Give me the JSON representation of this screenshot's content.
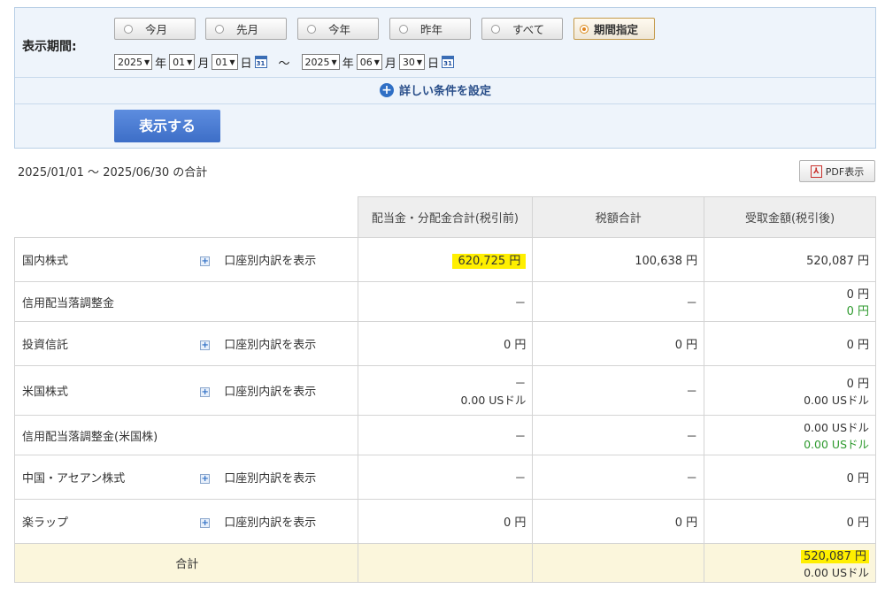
{
  "filter": {
    "label": "表示期間:",
    "periods": [
      {
        "label": "今月",
        "active": false
      },
      {
        "label": "先月",
        "active": false
      },
      {
        "label": "今年",
        "active": false
      },
      {
        "label": "昨年",
        "active": false
      },
      {
        "label": "すべて",
        "active": false
      },
      {
        "label": "期間指定",
        "active": true
      }
    ],
    "from": {
      "year": "2025",
      "month": "01",
      "day": "01"
    },
    "to": {
      "year": "2025",
      "month": "06",
      "day": "30"
    },
    "year_unit": "年",
    "month_unit": "月",
    "day_unit": "日",
    "tilde": "〜",
    "calendar_icon_text": "31",
    "more_conditions": "詳しい条件を設定",
    "show_button": "表示する"
  },
  "summary": {
    "range_text": "2025/01/01 〜 2025/06/30 の合計",
    "pdf_button": "PDF表示"
  },
  "table": {
    "headers": [
      "配当金・分配金合計(税引前)",
      "税額合計",
      "受取金額(税引後)"
    ],
    "breakdown_link": "口座別内訳を表示",
    "rows": [
      {
        "name": "国内株式",
        "link": true,
        "gross": [
          "620,725 円"
        ],
        "tax": [
          "100,638 円"
        ],
        "net": [
          "520,087 円"
        ],
        "gross_highlight": true
      },
      {
        "name": "信用配当落調整金",
        "link": false,
        "gross": [
          "－"
        ],
        "tax": [
          "－"
        ],
        "net": [
          "0 円",
          "0 円"
        ]
      },
      {
        "name": "投資信託",
        "link": true,
        "gross": [
          "0 円"
        ],
        "tax": [
          "0 円"
        ],
        "net": [
          "0 円"
        ]
      },
      {
        "name": "米国株式",
        "link": true,
        "gross": [
          "－",
          "0.00 USドル"
        ],
        "tax": [
          "－"
        ],
        "net": [
          "0 円",
          "0.00 USドル"
        ]
      },
      {
        "name": "信用配当落調整金(米国株)",
        "link": false,
        "gross": [
          "－"
        ],
        "tax": [
          "－"
        ],
        "net": [
          "0.00 USドル",
          "0.00 USドル"
        ]
      },
      {
        "name": "中国・アセアン株式",
        "link": true,
        "gross": [
          "－"
        ],
        "tax": [
          "－"
        ],
        "net": [
          "0 円"
        ]
      },
      {
        "name": "楽ラップ",
        "link": true,
        "gross": [
          "0 円"
        ],
        "tax": [
          "0 円"
        ],
        "net": [
          "0 円"
        ]
      }
    ],
    "total": {
      "label": "合計",
      "net": [
        "520,087 円",
        "0.00 USドル"
      ]
    }
  },
  "colors": {
    "highlight": "#ffef00",
    "green_text": "#2e9a2e",
    "primary_button": "#4a7bd0",
    "total_row_bg": "#fbf6dc"
  }
}
